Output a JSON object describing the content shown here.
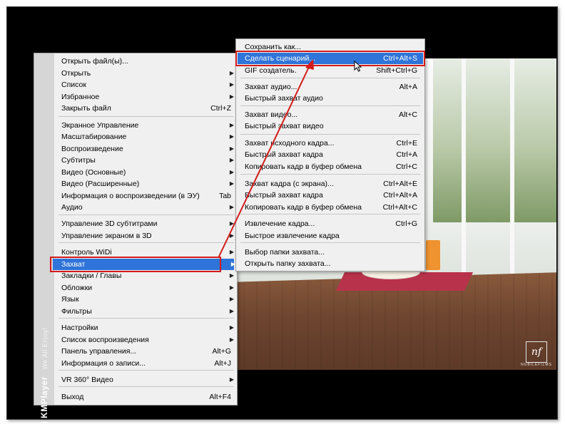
{
  "main_menu": {
    "items": [
      {
        "label": "Открыть файл(ы)...",
        "shortcut": "",
        "arrow": ""
      },
      {
        "label": "Открыть",
        "shortcut": "",
        "arrow": "▶"
      },
      {
        "label": "Список",
        "shortcut": "",
        "arrow": "▶"
      },
      {
        "label": "Избранное",
        "shortcut": "",
        "arrow": "▶"
      },
      {
        "label": "Закрыть файл",
        "shortcut": "Ctrl+Z",
        "arrow": ""
      },
      {
        "label": "Экранное Управление",
        "shortcut": "",
        "arrow": "▶"
      },
      {
        "label": "Масштабирование",
        "shortcut": "",
        "arrow": "▶"
      },
      {
        "label": "Воспроизведение",
        "shortcut": "",
        "arrow": "▶"
      },
      {
        "label": "Субтитры",
        "shortcut": "",
        "arrow": "▶"
      },
      {
        "label": "Видео (Основные)",
        "shortcut": "",
        "arrow": "▶"
      },
      {
        "label": "Видео (Расширенные)",
        "shortcut": "",
        "arrow": "▶"
      },
      {
        "label": "Информация о воспроизведении (в ЭУ)",
        "shortcut": "Tab",
        "arrow": ""
      },
      {
        "label": "Аудио",
        "shortcut": "",
        "arrow": "▶"
      },
      {
        "label": "Управление 3D субтитрами",
        "shortcut": "",
        "arrow": "▶"
      },
      {
        "label": "Управление экраном в 3D",
        "shortcut": "",
        "arrow": "▶"
      },
      {
        "label": "Контроль WiDi",
        "shortcut": "",
        "arrow": "▶"
      },
      {
        "label": "Захват",
        "shortcut": "",
        "arrow": "▶"
      },
      {
        "label": "Закладки / Главы",
        "shortcut": "",
        "arrow": "▶"
      },
      {
        "label": "Обложки",
        "shortcut": "",
        "arrow": "▶"
      },
      {
        "label": "Язык",
        "shortcut": "",
        "arrow": "▶"
      },
      {
        "label": "Фильтры",
        "shortcut": "",
        "arrow": "▶"
      },
      {
        "label": "Настройки",
        "shortcut": "",
        "arrow": "▶"
      },
      {
        "label": "Список воспроизведения",
        "shortcut": "",
        "arrow": "▶"
      },
      {
        "label": "Панель управления...",
        "shortcut": "Alt+G",
        "arrow": ""
      },
      {
        "label": "Информация о записи...",
        "shortcut": "Alt+J",
        "arrow": ""
      },
      {
        "label": "VR 360° Видео",
        "shortcut": "",
        "arrow": "▶"
      },
      {
        "label": "Выход",
        "shortcut": "Alt+F4",
        "arrow": ""
      }
    ],
    "highlighted_label": "Захват"
  },
  "capture_menu": {
    "items": [
      {
        "label": "Сохранить как...",
        "shortcut": ""
      },
      {
        "label": "Сделать сценарий...",
        "shortcut": "Ctrl+Alt+S"
      },
      {
        "label": "GIF создатель.",
        "shortcut": "Shift+Ctrl+G"
      },
      {
        "label": "Захват аудио...",
        "shortcut": "Alt+A"
      },
      {
        "label": "Быстрый захват аудио",
        "shortcut": ""
      },
      {
        "label": "Захват видео...",
        "shortcut": "Alt+C"
      },
      {
        "label": "Быстрый захват видео",
        "shortcut": ""
      },
      {
        "label": "Захват исходного кадра...",
        "shortcut": "Ctrl+E"
      },
      {
        "label": "Быстрый захват кадра",
        "shortcut": "Ctrl+A"
      },
      {
        "label": "Копировать кадр в буфер обмена",
        "shortcut": "Ctrl+C"
      },
      {
        "label": "Захват кадра (с экрана)...",
        "shortcut": "Ctrl+Alt+E"
      },
      {
        "label": "Быстрый захват кадра",
        "shortcut": "Ctrl+Alt+A"
      },
      {
        "label": "Копировать кадр в буфер обмена",
        "shortcut": "Ctrl+Alt+C"
      },
      {
        "label": "Извлечение кадра...",
        "shortcut": "Ctrl+G"
      },
      {
        "label": "Быстрое извлечение кадра",
        "shortcut": ""
      },
      {
        "label": "Выбор папки захвата...",
        "shortcut": ""
      },
      {
        "label": "Открыть папку захвата...",
        "shortcut": ""
      }
    ],
    "highlighted_label": "Сделать сценарий..."
  },
  "sidebar_brand": {
    "name": "KMPlayer",
    "tagline": "We All Enjoy!"
  },
  "video_logo": {
    "mark": "nf",
    "text": "NUBILEFILMS"
  },
  "colors": {
    "highlight": "#2f74d8",
    "annotation": "#d41a1a",
    "menu_bg": "#f0f0f0",
    "frame": "#000000"
  },
  "icons": {
    "submenu_arrow": "chevron-right-icon",
    "cursor": "mouse-pointer-icon"
  }
}
